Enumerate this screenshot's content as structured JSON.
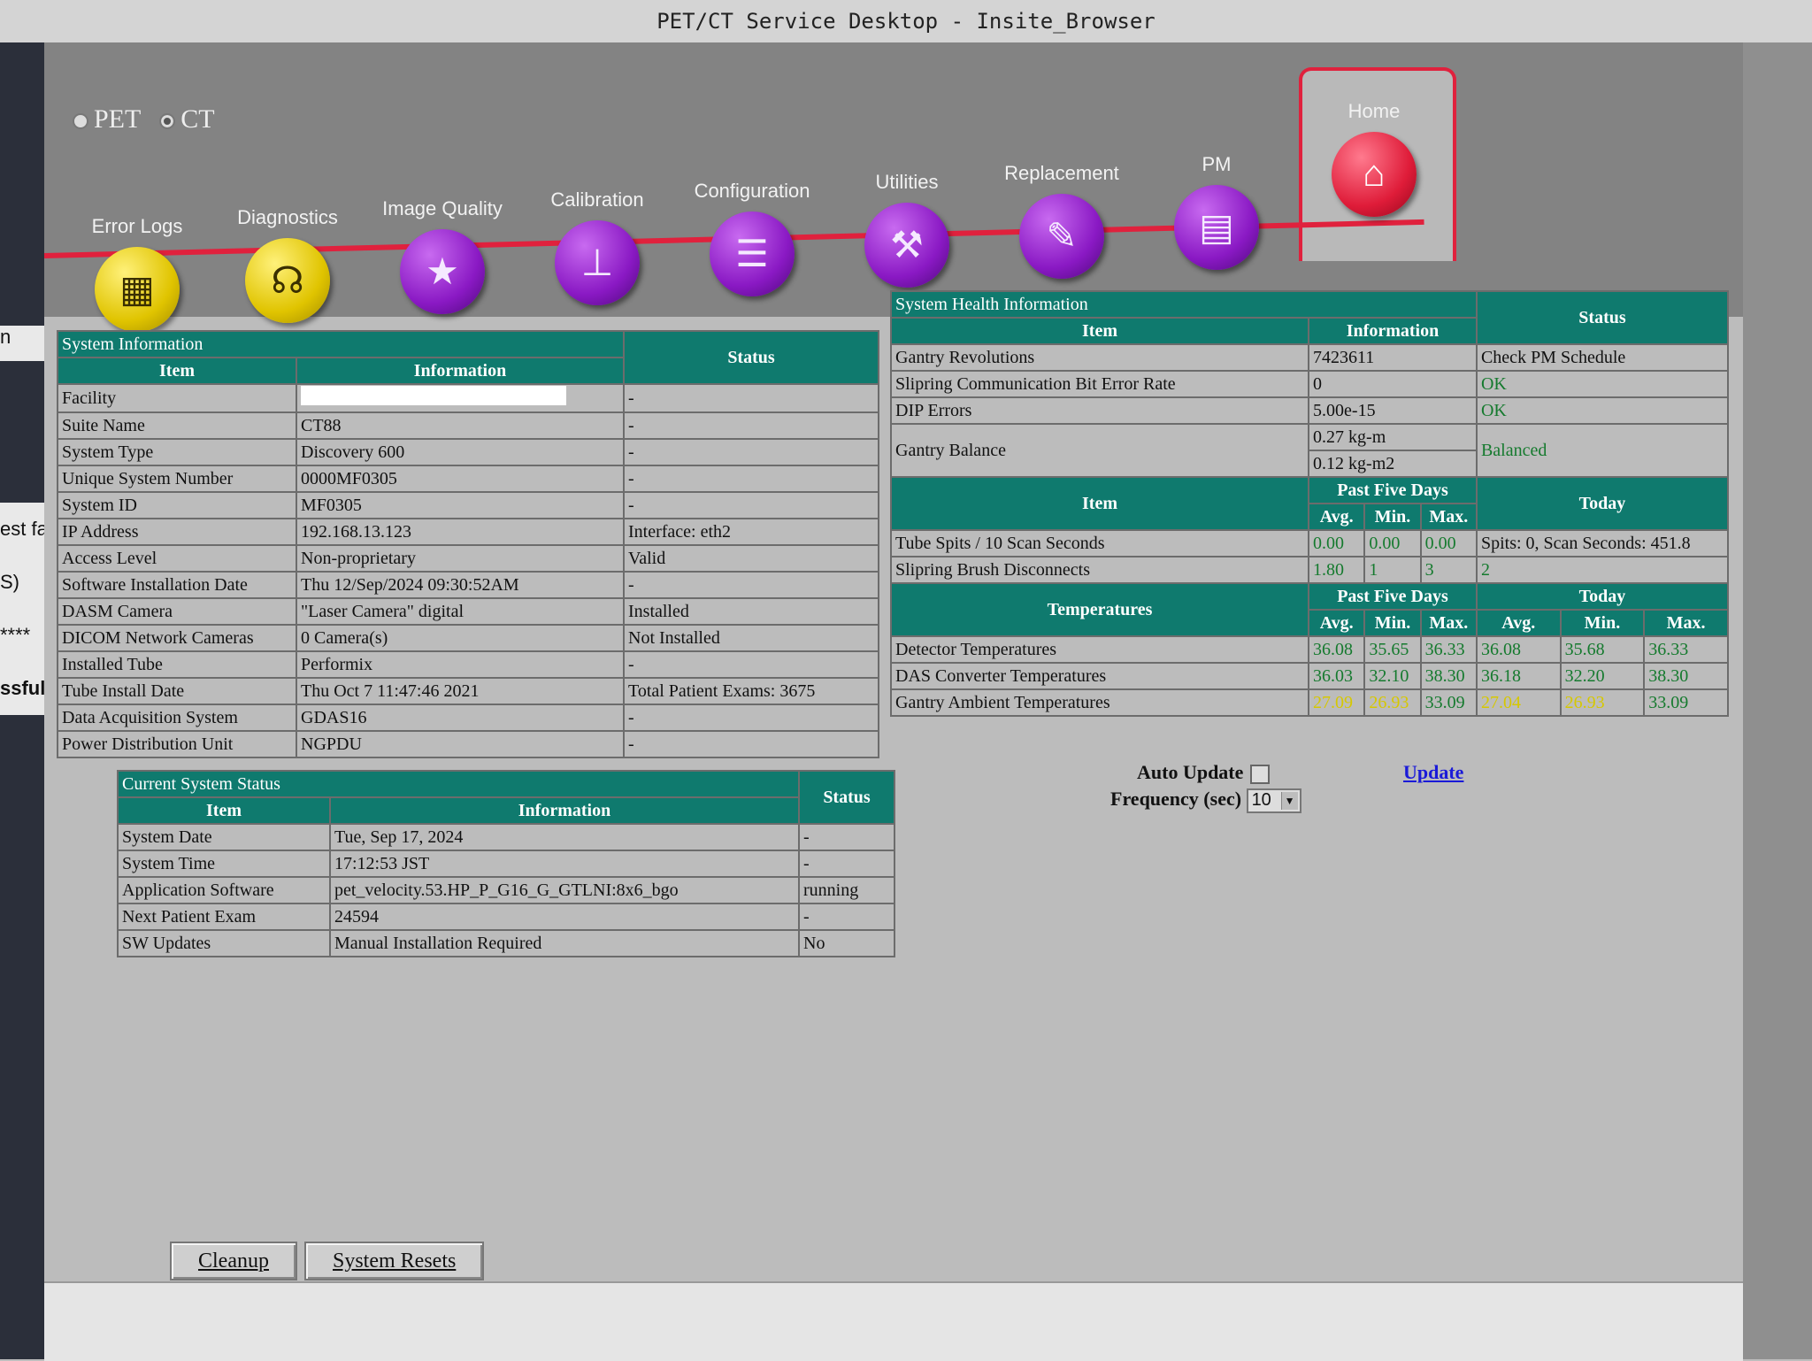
{
  "window": {
    "title": "PET/CT Service Desktop - Insite_Browser"
  },
  "left_fragments": [
    "n",
    "est fa",
    "S)",
    "****",
    "ssful."
  ],
  "modes": {
    "pet_label": "PET",
    "ct_label": "CT",
    "selected": "CT"
  },
  "nav": {
    "tabs": [
      {
        "label": "Error Logs",
        "icon": "spreadsheet-icon",
        "color": "yellow"
      },
      {
        "label": "Diagnostics",
        "icon": "stethoscope-icon",
        "color": "yellow"
      },
      {
        "label": "Image Quality",
        "icon": "monitor-star-icon",
        "color": "purple"
      },
      {
        "label": "Calibration",
        "icon": "caliper-icon",
        "color": "purple"
      },
      {
        "label": "Configuration",
        "icon": "checklist-icon",
        "color": "purple"
      },
      {
        "label": "Utilities",
        "icon": "toolbox-icon",
        "color": "purple"
      },
      {
        "label": "Replacement",
        "icon": "wrench-icon",
        "color": "purple"
      },
      {
        "label": "PM",
        "icon": "clipboard-wrench-icon",
        "color": "purple"
      },
      {
        "label": "Home",
        "icon": "home-icon",
        "color": "red"
      }
    ],
    "active": "Home"
  },
  "system_information": {
    "caption": "System Information",
    "status_header": "Status",
    "information_header": "Information",
    "item_header": "Item",
    "rows": [
      {
        "item": "Facility",
        "info": "",
        "status": "-"
      },
      {
        "item": "Suite Name",
        "info": "CT88",
        "status": "-"
      },
      {
        "item": "System Type",
        "info": "Discovery 600",
        "status": "-"
      },
      {
        "item": "Unique System Number",
        "info": "0000MF0305",
        "status": "-"
      },
      {
        "item": "System ID",
        "info": "MF0305",
        "status": "-"
      },
      {
        "item": "IP Address",
        "info": "192.168.13.123",
        "status": "Interface: eth2"
      },
      {
        "item": "Access Level",
        "info": "Non-proprietary",
        "status": "Valid"
      },
      {
        "item": "Software Installation Date",
        "info": "Thu 12/Sep/2024 09:30:52AM",
        "status": "-"
      },
      {
        "item": "DASM Camera",
        "info": "\"Laser Camera\" digital",
        "status": "Installed"
      },
      {
        "item": "DICOM Network Cameras",
        "info": "0 Camera(s)",
        "status": "Not Installed"
      },
      {
        "item": "Installed Tube",
        "info": "Performix",
        "status": "-"
      },
      {
        "item": "Tube Install Date",
        "info": "Thu Oct 7 11:47:46 2021",
        "status": "Total Patient Exams: 3675"
      },
      {
        "item": "Data Acquisition System",
        "info": "GDAS16",
        "status": "-"
      },
      {
        "item": "Power Distribution Unit",
        "info": "NGPDU",
        "status": "-"
      }
    ]
  },
  "current_system_status": {
    "caption": "Current System Status",
    "status_header": "Status",
    "information_header": "Information",
    "item_header": "Item",
    "rows": [
      {
        "item": "System Date",
        "info": "Tue, Sep 17, 2024",
        "status": "-"
      },
      {
        "item": "System Time",
        "info": "17:12:53 JST",
        "status": "-"
      },
      {
        "item": "Application Software",
        "info": "pet_velocity.53.HP_P_G16_G_GTLNI:8x6_bgo",
        "status": "running"
      },
      {
        "item": "Next Patient Exam",
        "info": "24594",
        "status": "-"
      },
      {
        "item": "SW Updates",
        "info": "Manual Installation Required",
        "status": "No"
      }
    ]
  },
  "system_health": {
    "caption": "System Health Information",
    "item_header": "Item",
    "information_header": "Information",
    "status_header": "Status",
    "rows": [
      {
        "item": "Gantry Revolutions",
        "info": "7423611",
        "status": "Check PM Schedule"
      },
      {
        "item": "Slipring Communication Bit Error Rate",
        "info": "0",
        "status": "OK"
      },
      {
        "item": "DIP Errors",
        "info": "5.00e-15",
        "status": "OK"
      },
      {
        "item": "Gantry Balance",
        "info": "0.27 kg-m",
        "info2": "0.12 kg-m2",
        "status": "Balanced"
      }
    ],
    "past_five_days": "Past Five Days",
    "today": "Today",
    "avg": "Avg.",
    "min": "Min.",
    "max": "Max.",
    "spits_rows": [
      {
        "item": "Tube Spits / 10 Scan Seconds",
        "avg": "0.00",
        "min": "0.00",
        "max": "0.00",
        "today": "Spits: 0, Scan Seconds: 451.8"
      },
      {
        "item": "Slipring Brush Disconnects",
        "avg": "1.80",
        "min": "1",
        "max": "3",
        "today": "2"
      }
    ],
    "temperatures_header": "Temperatures",
    "temp_rows": [
      {
        "item": "Detector Temperatures",
        "p_avg": "36.08",
        "p_min": "35.65",
        "p_max": "36.33",
        "t_avg": "36.08",
        "t_min": "35.68",
        "t_max": "36.33"
      },
      {
        "item": "DAS Converter Temperatures",
        "p_avg": "36.03",
        "p_min": "32.10",
        "p_max": "38.30",
        "t_avg": "36.18",
        "t_min": "32.20",
        "t_max": "38.30"
      },
      {
        "item": "Gantry Ambient Temperatures",
        "p_avg": "27.09",
        "p_min": "26.93",
        "p_max": "33.09",
        "t_avg": "27.04",
        "t_min": "26.93",
        "t_max": "33.09"
      }
    ]
  },
  "auto_update": {
    "label": "Auto Update",
    "checked": false,
    "frequency_label": "Frequency (sec)",
    "frequency_value": "10",
    "update_link": "Update"
  },
  "footer": {
    "cleanup": "Cleanup",
    "system_resets": "System Resets"
  }
}
